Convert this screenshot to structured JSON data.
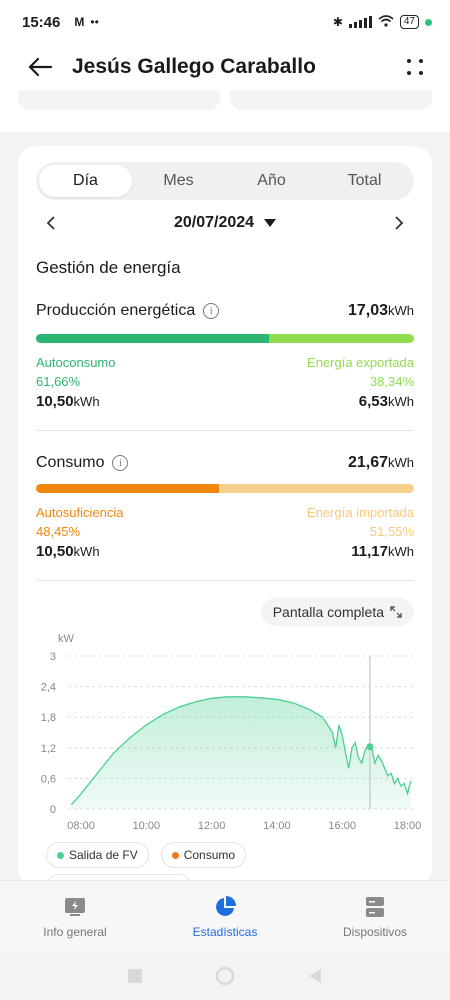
{
  "status": {
    "time": "15:46",
    "notif": "M",
    "dots": "••",
    "battery": "47"
  },
  "header": {
    "title": "Jesús Gallego Caraballo"
  },
  "tabs": [
    {
      "label": "Día",
      "active": true
    },
    {
      "label": "Mes",
      "active": false
    },
    {
      "label": "Año",
      "active": false
    },
    {
      "label": "Total",
      "active": false
    }
  ],
  "date": "20/07/2024",
  "section_title": "Gestión de energía",
  "production": {
    "label": "Producción energética",
    "total": "17,03",
    "unit": "kWh",
    "self_label": "Autoconsumo",
    "self_pct": "61,66%",
    "self_val": "10,50",
    "export_label": "Energía exportada",
    "export_pct": "38,34%",
    "export_val": "6,53",
    "split_fraction": 0.6166,
    "colors": {
      "primary": "#2bb673",
      "secondary": "#8fdc4e"
    }
  },
  "consumption": {
    "label": "Consumo",
    "total": "21,67",
    "unit": "kWh",
    "self_label": "Autosuficiencia",
    "self_pct": "48,45%",
    "self_val": "10,50",
    "import_label": "Energía importada",
    "import_pct": "51,55%",
    "import_val": "11,17",
    "split_fraction": 0.4845,
    "colors": {
      "primary": "#f0870f",
      "secondary": "#f7d08c"
    }
  },
  "fullscreen_label": "Pantalla completa",
  "chart_data": {
    "type": "area",
    "ylabel": "kW",
    "yticks": [
      "0",
      "0,6",
      "1,2",
      "1,8",
      "2,4",
      "3"
    ],
    "ylim": [
      0,
      3
    ],
    "xticks": [
      "08:00",
      "10:00",
      "12:00",
      "14:00",
      "16:00",
      "18:00"
    ],
    "xlim": [
      7.6,
      18.2
    ],
    "series": [
      {
        "name": "Salida de FV",
        "color": "#4ccf93",
        "x": [
          7.7,
          8.0,
          8.5,
          9.0,
          9.5,
          10.0,
          10.5,
          11.0,
          11.5,
          12.0,
          12.5,
          13.0,
          13.5,
          14.0,
          14.5,
          15.0,
          15.4,
          15.7,
          15.8,
          15.9,
          16.0,
          16.1,
          16.2,
          16.3,
          16.4,
          16.5,
          16.6,
          16.7,
          16.8,
          16.9,
          17.0,
          17.1,
          17.2,
          17.3,
          17.4,
          17.5,
          17.6,
          17.7,
          17.8,
          17.9,
          18.0,
          18.1
        ],
        "y": [
          0.08,
          0.3,
          0.7,
          1.1,
          1.4,
          1.65,
          1.85,
          2.0,
          2.1,
          2.17,
          2.2,
          2.2,
          2.18,
          2.15,
          2.08,
          1.95,
          1.8,
          1.5,
          1.2,
          1.65,
          1.45,
          1.1,
          0.8,
          1.2,
          1.3,
          1.0,
          0.9,
          1.15,
          1.25,
          1.22,
          0.9,
          1.05,
          0.95,
          0.8,
          0.65,
          0.7,
          0.5,
          0.6,
          0.45,
          0.5,
          0.3,
          0.55
        ]
      }
    ],
    "marker": {
      "x": 16.85,
      "y": 1.22
    },
    "legend": [
      "Salida de FV",
      "Consumo"
    ],
    "legend_colors": [
      "#4ccf93",
      "#f07a1a"
    ],
    "grid": true
  },
  "bottom_nav": [
    {
      "label": "Info general",
      "active": false
    },
    {
      "label": "Estadísticas",
      "active": true
    },
    {
      "label": "Dispositivos",
      "active": false
    }
  ]
}
